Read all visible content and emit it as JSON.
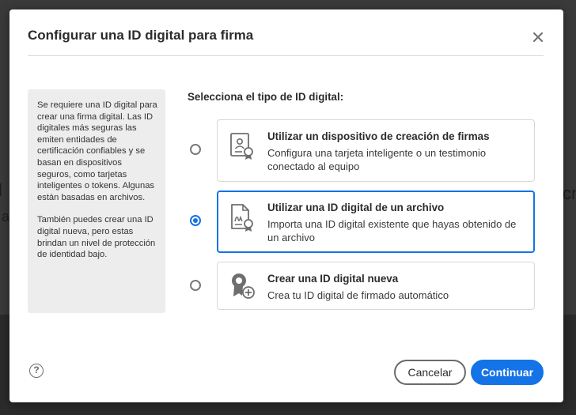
{
  "dialog": {
    "title": "Configurar una ID digital para firma",
    "close_icon": "close-icon",
    "info_paragraphs": [
      "Se requiere una ID digital para crear una firma digital. Las ID digitales más seguras las emiten entidades de certificación confiables y se basan en dispositivos seguros, como tarjetas inteligentes o tokens. Algunas están basadas en archivos.",
      "También puedes crear una ID digital nueva, pero estas brindan un nivel de protección de identidad bajo."
    ],
    "select_label": "Selecciona el tipo de ID digital:",
    "options": [
      {
        "title": "Utilizar un dispositivo de creación de firmas",
        "description": "Configura una tarjeta inteligente o un testimonio conectado al equipo",
        "icon": "signature-device-icon",
        "selected": false
      },
      {
        "title": "Utilizar una ID digital de un archivo",
        "description": "Importa una ID digital existente que hayas obtenido de un archivo",
        "icon": "certificate-file-icon",
        "selected": true
      },
      {
        "title": "Crear una ID digital nueva",
        "description": "Crea tu ID digital de firmado automático",
        "icon": "new-digital-id-icon",
        "selected": false
      }
    ],
    "help_label": "?",
    "cancel_label": "Cancelar",
    "continue_label": "Continuar"
  },
  "background": {
    "left_fragment_1": "l",
    "left_fragment_2": "a",
    "right_fragment": "cr"
  },
  "colors": {
    "accent": "#1473e6",
    "overlay": "#3a3a3a"
  }
}
